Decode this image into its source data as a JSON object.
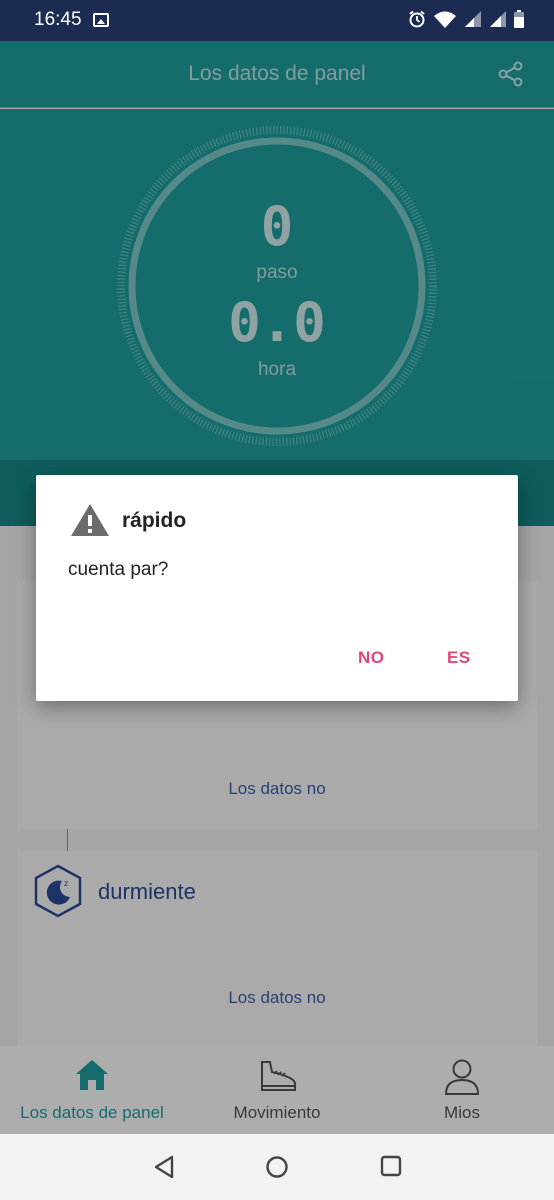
{
  "status_bar": {
    "time": "16:45"
  },
  "header": {
    "title": "Los datos de panel"
  },
  "dashboard": {
    "steps_value": "0",
    "steps_label": "paso",
    "hours_value": "0.0",
    "hours_label": "hora"
  },
  "cards": {
    "activity_nodata": "Los datos no",
    "sleep_title": "durmiente",
    "sleep_nodata": "Los datos no"
  },
  "bottom_nav": {
    "home": "Los datos de panel",
    "movement": "Movimiento",
    "mine": "Mios"
  },
  "dialog": {
    "title": "rápido",
    "message": "cuenta par?",
    "no_label": "NO",
    "yes_label": "ES"
  },
  "colors": {
    "teal": "#1fa0a0",
    "accent_pink": "#e0457b",
    "navy": "#1b2b52"
  },
  "icons": {
    "header": "share-icon",
    "dialog": "warning-icon",
    "sleep": "moon-icon",
    "nav": [
      "home-icon",
      "shoe-icon",
      "person-icon"
    ]
  }
}
